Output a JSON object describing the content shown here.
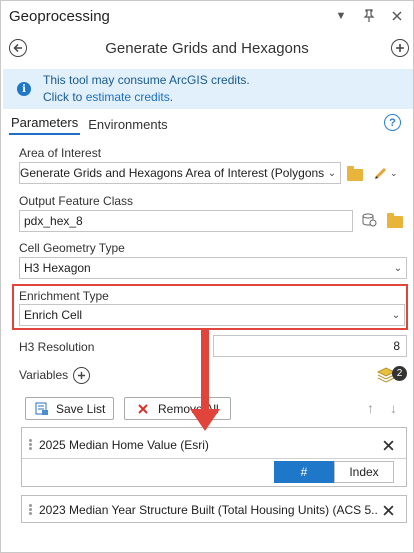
{
  "window": {
    "title": "Geoprocessing"
  },
  "tool": {
    "title": "Generate Grids and Hexagons"
  },
  "banner": {
    "line1": "This tool may consume ArcGIS credits.",
    "line2_prefix": "Click to ",
    "line2_link": "estimate credits",
    "line2_suffix": "."
  },
  "tabs": [
    {
      "label": "Parameters",
      "active": true
    },
    {
      "label": "Environments",
      "active": false
    }
  ],
  "params": {
    "area_of_interest": {
      "label": "Area of Interest",
      "value": "Generate Grids and Hexagons Area of Interest (Polygons)"
    },
    "output_feature_class": {
      "label": "Output Feature Class",
      "value": "pdx_hex_8"
    },
    "cell_geometry_type": {
      "label": "Cell Geometry Type",
      "value": "H3 Hexagon"
    },
    "enrichment_type": {
      "label": "Enrichment Type",
      "value": "Enrich Cell"
    },
    "h3_resolution": {
      "label": "H3 Resolution",
      "value": "8"
    },
    "variables": {
      "label": "Variables",
      "count": "2"
    }
  },
  "actions": {
    "save_list": "Save List",
    "remove_all": "Remove All"
  },
  "variables_list": [
    {
      "name": "2025 Median Home Value (Esri)"
    },
    {
      "name": "2023 Median Year Structure Built (Total Housing Units) (ACS 5..."
    }
  ],
  "display_toggle": {
    "options": [
      "#",
      "Index"
    ],
    "selected": "#"
  },
  "colors": {
    "accent": "#1f77c9",
    "highlight": "#e0443b",
    "banner_bg": "#e1f0fb"
  }
}
